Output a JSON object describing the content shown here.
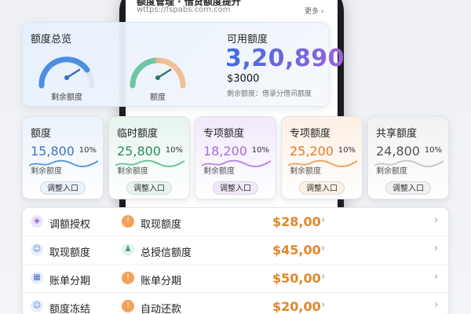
{
  "header": {
    "title": "额度管理 · 借贷额度提升",
    "url": "wttps://fspabs.com.com",
    "more": "更多 ›"
  },
  "overview": {
    "title": "额度总览",
    "gauges": [
      {
        "label": "剩余额度",
        "level": 0.72,
        "color": "#4a90e2"
      },
      {
        "label": "额度",
        "level": 0.62,
        "color": "#5bc4a0"
      }
    ],
    "available_title": "可用额度",
    "available_value": "3,20,890",
    "available_sub": "$3000",
    "available_note": "剩余额度：借录分借讯额度"
  },
  "cards": [
    {
      "title": "额度",
      "value": "15,800",
      "pct": "10%",
      "note": "剩余额度",
      "button": "调整入口",
      "accent": "#3b74c8",
      "bg": "#eaf2fb",
      "wave": "#5c9be0"
    },
    {
      "title": "临时额度",
      "value": "25,800",
      "pct": "10%",
      "note": "剩余额度",
      "button": "调整入口",
      "accent": "#2c8a5a",
      "bg": "#e6f5ee",
      "wave": "#6cc59b"
    },
    {
      "title": "专项额度",
      "value": "18,200",
      "pct": "10%",
      "note": "剩余额度",
      "button": "调整入口",
      "accent": "#a86de0",
      "bg": "#f1e9fb",
      "wave": "#b98ae8"
    },
    {
      "title": "专项额度",
      "value": "25,200",
      "pct": "10%",
      "note": "剩余额度",
      "button": "调整入口",
      "accent": "#e37e22",
      "bg": "#fdf0e4",
      "wave": "#f0a560"
    },
    {
      "title": "共享额度",
      "value": "24,800",
      "pct": "10%",
      "note": "剩余额度",
      "button": "调整入口",
      "accent": "#555555",
      "bg": "#f0f1f3",
      "wave": "#c7c9cd"
    }
  ],
  "list": {
    "rows": [
      {
        "left_icon": "shield-icon",
        "left_label": "调额授权",
        "right_icon": "alert-icon",
        "right_label": "取现额度",
        "amount": "$28,00"
      },
      {
        "left_icon": "user-icon",
        "left_label": "取现额度",
        "right_icon": "group-icon",
        "right_label": "总授信额度",
        "amount": "$45,00"
      },
      {
        "left_icon": "calendar-icon",
        "left_label": "账单分期",
        "right_icon": "alert-icon",
        "right_label": "账单分期",
        "amount": "$50,00"
      },
      {
        "left_icon": "user-icon",
        "left_label": "额度冻结",
        "right_icon": "alert-icon",
        "right_label": "自动还款",
        "amount": "$20,00"
      }
    ]
  }
}
